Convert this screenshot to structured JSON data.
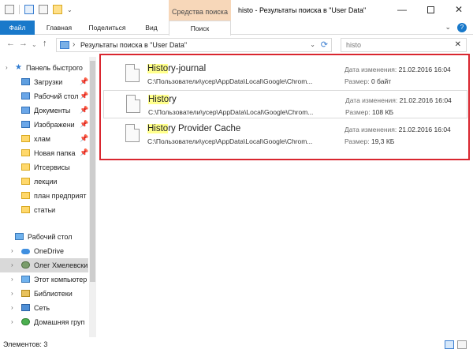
{
  "window": {
    "title": "histo - Результаты поиска в \"User Data\"",
    "context_tab_title": "Средства поиска",
    "controls": {
      "minimize": "—",
      "close": "✕"
    }
  },
  "ribbon": {
    "tabs": [
      {
        "label": "Файл"
      },
      {
        "label": "Главная"
      },
      {
        "label": "Поделиться"
      },
      {
        "label": "Вид"
      },
      {
        "label": "Поиск"
      }
    ],
    "expand": "⌄",
    "help": "?"
  },
  "address": {
    "path": "Результаты поиска в \"User Data\"",
    "search_value": "histo",
    "nav_back": "←",
    "nav_forward": "→",
    "nav_up": "↑",
    "separator": "›",
    "dropdown": "⌄",
    "refresh": "⟳",
    "clear": "✕"
  },
  "navpane": {
    "quick_access": [
      {
        "label": "Панель быстрого",
        "icon": "star-icon",
        "pinned": false
      },
      {
        "label": "Загрузки",
        "icon": "download-folder-icon",
        "pinned": true
      },
      {
        "label": "Рабочий стол",
        "icon": "desktop-icon",
        "pinned": true
      },
      {
        "label": "Документы",
        "icon": "documents-icon",
        "pinned": true
      },
      {
        "label": "Изображени",
        "icon": "pictures-icon",
        "pinned": true
      },
      {
        "label": "хлам",
        "icon": "folder-icon",
        "pinned": true
      },
      {
        "label": "Новая папка",
        "icon": "folder-icon",
        "pinned": true
      },
      {
        "label": "Итсервисы",
        "icon": "folder-icon",
        "pinned": false
      },
      {
        "label": "лекции",
        "icon": "folder-icon",
        "pinned": false
      },
      {
        "label": "план предприят",
        "icon": "folder-icon",
        "pinned": false
      },
      {
        "label": "статьи",
        "icon": "folder-icon",
        "pinned": false
      }
    ],
    "root": [
      {
        "label": "Рабочий стол",
        "icon": "desktop-icon"
      },
      {
        "label": "OneDrive",
        "icon": "onedrive-icon"
      },
      {
        "label": "Олег Хмелевски",
        "icon": "user-icon",
        "selected": true
      },
      {
        "label": "Этот компьютер",
        "icon": "computer-icon"
      },
      {
        "label": "Библиотеки",
        "icon": "libraries-icon"
      },
      {
        "label": "Сеть",
        "icon": "network-icon"
      },
      {
        "label": "Домашняя груп",
        "icon": "homegroup-icon"
      }
    ],
    "pin_glyph": "📌",
    "expander_glyph": "›"
  },
  "results": {
    "items": [
      {
        "name_highlight": "Histo",
        "name_rest": "ry-journal",
        "path": "C:\\Пользователи\\усер\\AppData\\Local\\Google\\Chrom...",
        "modified_label": "Дата изменения:",
        "modified_value": "21.02.2016 16:04",
        "size_label": "Размер:",
        "size_value": "0 байт"
      },
      {
        "name_highlight": "Histo",
        "name_rest": "ry",
        "path": "C:\\Пользователи\\усер\\AppData\\Local\\Google\\Chrom...",
        "modified_label": "Дата изменения:",
        "modified_value": "21.02.2016 16:04",
        "size_label": "Размер:",
        "size_value": "108 КБ"
      },
      {
        "name_highlight": "Histo",
        "name_rest": "ry Provider Cache",
        "path": "C:\\Пользователи\\усер\\AppData\\Local\\Google\\Chrom...",
        "modified_label": "Дата изменения:",
        "modified_value": "21.02.2016 16:04",
        "size_label": "Размер:",
        "size_value": "19,3 КБ"
      }
    ],
    "highlight_color": "#ffff8c",
    "frame_color": "#d9262f"
  },
  "status": {
    "items_count": "Элементов: 3"
  }
}
